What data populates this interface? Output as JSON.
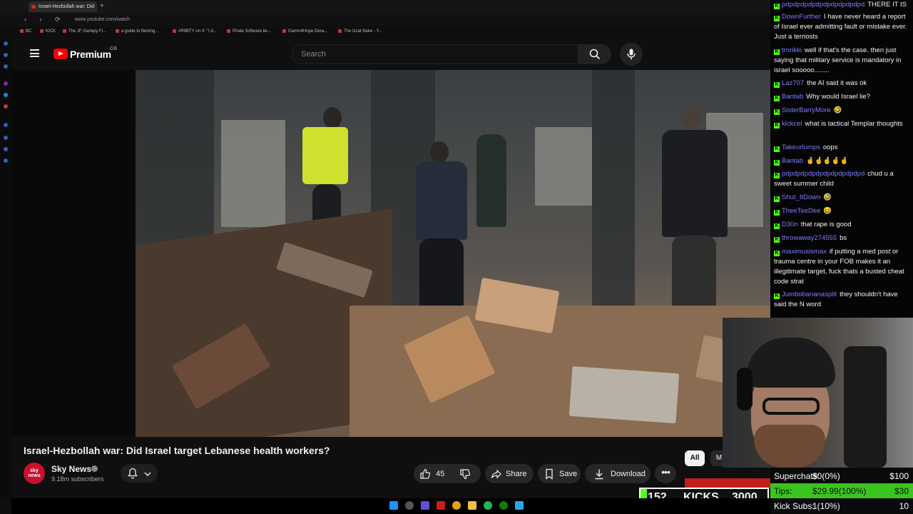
{
  "browser": {
    "tab_title": "Israel-Hezbollah war: Did",
    "tab_new": "+",
    "nav_glyphs": "‹ › ⟳",
    "url": "www.youtube.com/watch",
    "bookmarks": [
      "BC",
      "KICK",
      "The JF Gariepy Fi...",
      "a guide to flaming...",
      "#R9BTY on X: \"I d...",
      "Pirate Software lie...",
      "Gamin4Hope Dera...",
      "The Izzat Nuke - Y..."
    ]
  },
  "youtube": {
    "brand": "Premium",
    "region": "GB",
    "search_placeholder": "Search"
  },
  "video": {
    "title": "Israel-Hezbollah war: Did Israel target Lebanese health workers?",
    "channel": "Sky News",
    "avatar_text": "sky news",
    "subscribers": "9.18m subscribers",
    "likes": "45",
    "share_label": "Share",
    "save_label": "Save",
    "download_label": "Download",
    "more_label": "•••",
    "chip_all": "All",
    "chip_more": "M"
  },
  "chat": [
    {
      "user": "pdpdpdpdpdpdpdpdpdpdpd",
      "text": "THERE IT IS"
    },
    {
      "user": "DownFurther",
      "text": "I have never heard a report of Israel ever admitting fault or mistake ever. Just a terriosts"
    },
    {
      "user": "trorikki",
      "text": "well if that's the case. then just saying that military service is mandatory in israel sooooo........"
    },
    {
      "user": "Laz707",
      "text": "the AI said it was ok"
    },
    {
      "user": "Bantab",
      "text": "Why would Israel lie?"
    },
    {
      "user": "SisterBarryMore",
      "text": "🤣"
    },
    {
      "user": "kickcel",
      "text": "what is tactical Templar thoughts"
    },
    {
      "user": "Takeurlumps",
      "text": "oops"
    },
    {
      "user": "Bantab",
      "text": "🤞🤞🤞🤞🤞"
    },
    {
      "user": "pdpdpdpdpdpdpdpdpdpdpd",
      "text": "chud u a sweet summer child"
    },
    {
      "user": "Shut_ItDown",
      "text": "🤣"
    },
    {
      "user": "TheeTeeDee",
      "text": "😆"
    },
    {
      "user": "D30n",
      "text": "that rape is good"
    },
    {
      "user": "throwaway274555",
      "text": "bs"
    },
    {
      "user": "maximusismax",
      "text": "if putting a med post or trauma centre in your FOB makes it an illegitimate target, fuck thats a busted cheat code strat"
    },
    {
      "user": "Jumbobananasplit",
      "text": "they shouldn't have said the N word"
    }
  ],
  "stats": {
    "superchats_label": "Superchats:",
    "superchats_value": "$0(0%)",
    "superchats_goal": "$100",
    "tips_label": "Tips:",
    "tips_value": "$29.99(100%)",
    "tips_goal": "$30",
    "kick_subs_label": "Kick Subs:",
    "kick_subs_value": "1(10%)",
    "kick_subs_goal": "10"
  },
  "kicks": {
    "current": "152",
    "label": "KICKS",
    "goal": "3000",
    "progress": 0.0507
  },
  "colors": {
    "kick_green": "#53fc18",
    "youtube_red": "#ff0000",
    "chat_username": "#7c7cff"
  }
}
